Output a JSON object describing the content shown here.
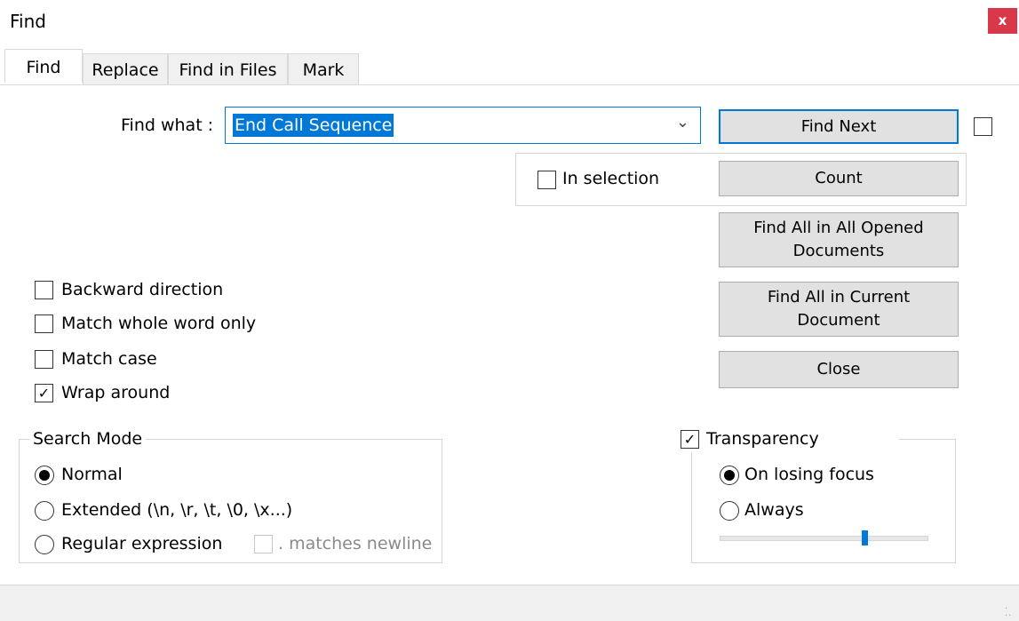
{
  "window": {
    "title": "Find",
    "close_label": "x"
  },
  "tabs": [
    {
      "label": "Find",
      "active": true
    },
    {
      "label": "Replace",
      "active": false
    },
    {
      "label": "Find in Files",
      "active": false
    },
    {
      "label": "Mark",
      "active": false
    }
  ],
  "find_what": {
    "label": "Find what :",
    "value": "End Call Sequence"
  },
  "buttons": {
    "find_next": "Find Next",
    "count": "Count",
    "find_all_opened_line1": "Find All in All Opened",
    "find_all_opened_line2": "Documents",
    "find_all_current_line1": "Find All in Current",
    "find_all_current_line2": "Document",
    "close": "Close"
  },
  "in_selection": {
    "label": "In selection",
    "checked": false
  },
  "options": [
    {
      "label": "Backward direction",
      "checked": false
    },
    {
      "label": "Match whole word only",
      "checked": false
    },
    {
      "label": "Match case",
      "checked": false
    },
    {
      "label": "Wrap around",
      "checked": true
    }
  ],
  "search_mode": {
    "legend": "Search Mode",
    "normal": "Normal",
    "extended": "Extended (\\n, \\r, \\t, \\0, \\x...)",
    "regex": "Regular expression",
    "matches_newline": ". matches newline",
    "selected": "Normal"
  },
  "transparency": {
    "label": "Transparency",
    "checked": true,
    "on_losing_focus": "On losing focus",
    "always": "Always",
    "selected": "On losing focus",
    "level": 0.7
  },
  "colors": {
    "accent": "#0078d7",
    "close_button": "#d9384b"
  }
}
